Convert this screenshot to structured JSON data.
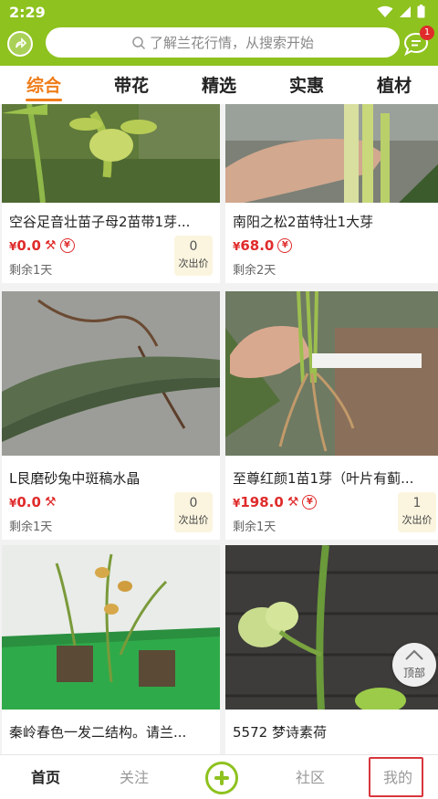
{
  "status": {
    "time": "2:29"
  },
  "search": {
    "placeholder": "了解兰花行情，从搜索开始"
  },
  "messages": {
    "badge": "1"
  },
  "tabs": [
    "综合",
    "带花",
    "精选",
    "实惠",
    "植材"
  ],
  "currency": "¥",
  "cards": [
    {
      "title": "空谷足音壮苗子母2苗带1芽...",
      "price": "0.0",
      "has_yuan": true,
      "remain": "剩余1天",
      "bids": "0",
      "bids_label": "次出价"
    },
    {
      "title": "南阳之松2苗特壮1大芽",
      "price": "68.0",
      "has_yuan": true,
      "remain": "剩余2天"
    },
    {
      "title": "L艮磨砂兔中斑稿水晶",
      "price": "0.0",
      "has_yuan": false,
      "remain": "剩余1天",
      "bids": "0",
      "bids_label": "次出价"
    },
    {
      "title": "至尊红颜1苗1芽（叶片有蓟...",
      "price": "198.0",
      "has_yuan": true,
      "remain": "剩余1天",
      "bids": "1",
      "bids_label": "次出价"
    },
    {
      "title": "秦岭春色一发二结构。请兰...",
      "price": "",
      "has_yuan": false
    },
    {
      "title": "5572 梦诗素荷",
      "price": "",
      "has_yuan": false
    }
  ],
  "top_button": {
    "label": "顶部"
  },
  "bottom_nav": {
    "home": "首页",
    "follow": "关注",
    "community": "社区",
    "mine": "我的"
  },
  "colors": {
    "brand_green": "#8ec21f",
    "accent_orange": "#ef7d1a",
    "price_red": "#e02b2b"
  }
}
